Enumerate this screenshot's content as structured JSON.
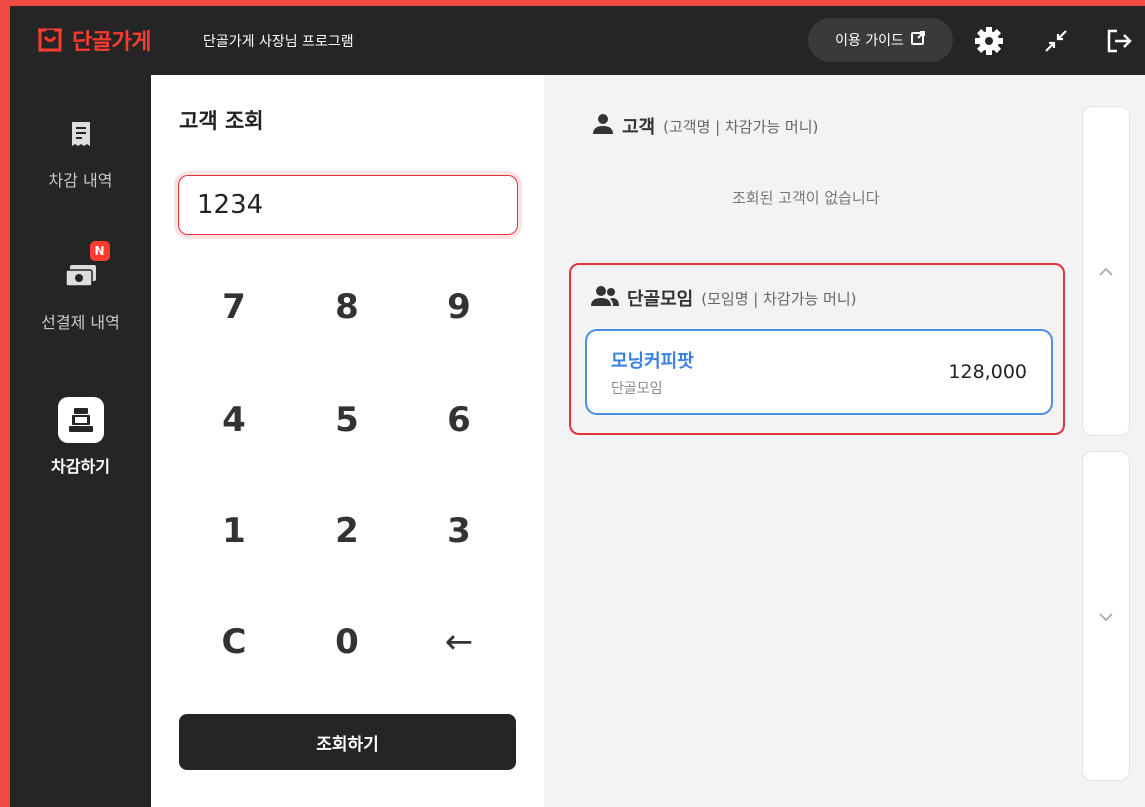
{
  "header": {
    "brand": "단골가게",
    "subtitle": "단골가게 사장님 프로그램",
    "guide_label": "이용 가이드"
  },
  "sidebar": {
    "items": [
      {
        "label": "차감 내역",
        "icon": "receipt-icon"
      },
      {
        "label": "선결제 내역",
        "icon": "cash-icon",
        "badge": "N"
      },
      {
        "label": "차감하기",
        "icon": "cash-register-icon",
        "active": true
      }
    ]
  },
  "keypad": {
    "title": "고객 조회",
    "input_value": "1234",
    "keys": [
      "7",
      "8",
      "9",
      "4",
      "5",
      "6",
      "1",
      "2",
      "3",
      "C",
      "0",
      "←"
    ],
    "search_label": "조회하기"
  },
  "results": {
    "customer": {
      "title": "고객",
      "sub": "(고객명 | 차감가능 머니)",
      "empty_text": "조회된 고객이 없습니다"
    },
    "group": {
      "title": "단골모임",
      "sub": "(모임명 | 차감가능 머니)",
      "items": [
        {
          "name": "모닝커피팟",
          "type": "단골모임",
          "amount": "128,000"
        }
      ]
    }
  },
  "colors": {
    "brand_red": "#ff3b30",
    "highlight_blue": "#3b82e0",
    "dark_bg": "#252525"
  }
}
